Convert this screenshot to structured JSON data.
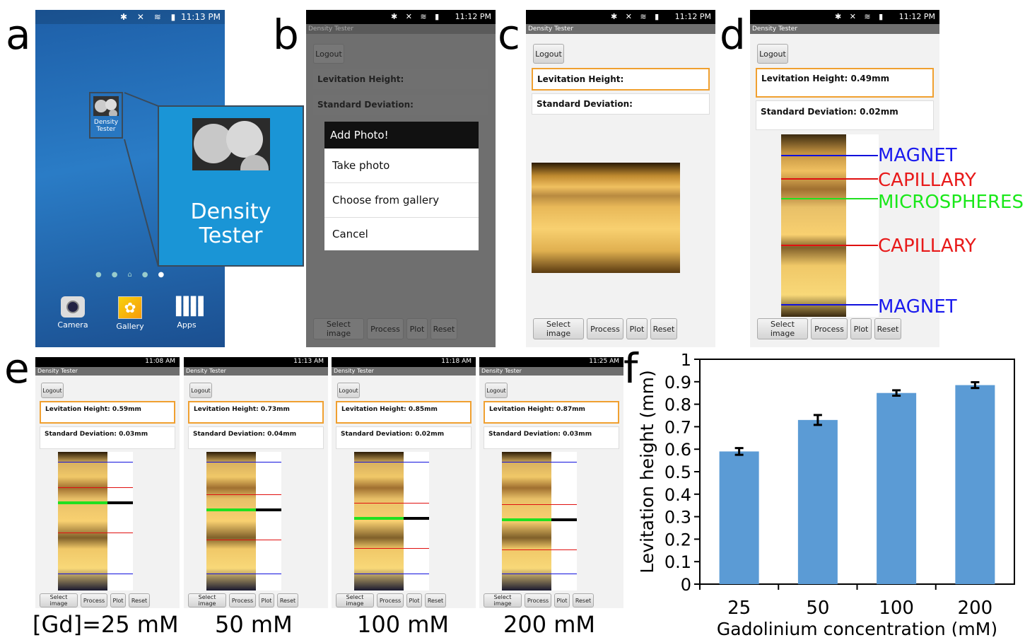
{
  "panels": {
    "a": "a",
    "b": "b",
    "c": "c",
    "d": "d",
    "e": "e",
    "f": "f"
  },
  "app": {
    "title": "Density Tester",
    "launcher_label": "Density\nTester",
    "big_label": "Density Tester"
  },
  "status": {
    "time_a": "11:13 PM",
    "time_bcd": "11:12 PM",
    "times_e": [
      "11:08 AM",
      "11:13 AM",
      "11:18 AM",
      "11:25 AM"
    ]
  },
  "home": {
    "dock": [
      "Camera",
      "Gallery",
      "Apps"
    ]
  },
  "buttons": {
    "logout": "Logout",
    "select": "Select image",
    "process": "Process",
    "plot": "Plot",
    "reset": "Reset"
  },
  "fields": {
    "lev_empty": "Levitation Height:",
    "sd_empty": "Standard Deviation:",
    "lev_d": "Levitation Height: 0.49mm",
    "sd_d": "Standard Deviation: 0.02mm"
  },
  "dialog": {
    "title": "Add Photo!",
    "items": [
      "Take photo",
      "Choose from gallery",
      "Cancel"
    ]
  },
  "annotations": {
    "magnet": "MAGNET",
    "capillary": "CAPILLARY",
    "micro": "MICROSPHERES"
  },
  "e_panels": [
    {
      "lev": "Levitation Height: 0.59mm",
      "sd": "Standard Deviation: 0.03mm",
      "caption": "[Gd]=25 mM"
    },
    {
      "lev": "Levitation Height: 0.73mm",
      "sd": "Standard Deviation: 0.04mm",
      "caption": "50 mM"
    },
    {
      "lev": "Levitation Height: 0.85mm",
      "sd": "Standard Deviation: 0.02mm",
      "caption": "100 mM"
    },
    {
      "lev": "Levitation Height: 0.87mm",
      "sd": "Standard Deviation: 0.03mm",
      "caption": "200 mM"
    }
  ],
  "colors": {
    "accent": "#f0a030",
    "bar": "#5b9bd5",
    "magnet": "#1010dd",
    "capillary": "#e01010",
    "micro": "#20e020"
  },
  "chart_data": {
    "type": "bar",
    "categories": [
      "25",
      "50",
      "100",
      "200"
    ],
    "values": [
      0.59,
      0.73,
      0.85,
      0.885
    ],
    "errors": [
      0.015,
      0.022,
      0.012,
      0.013
    ],
    "ylabel": "Levitation height  (mm)",
    "xlabel": "Gadolinium concentration (mM)",
    "ylim": [
      0,
      1
    ],
    "yticks": [
      "0",
      "0.1",
      "0.2",
      "0.3",
      "0.4",
      "0.5",
      "0.6",
      "0.7",
      "0.8",
      "0.9",
      "1"
    ]
  }
}
